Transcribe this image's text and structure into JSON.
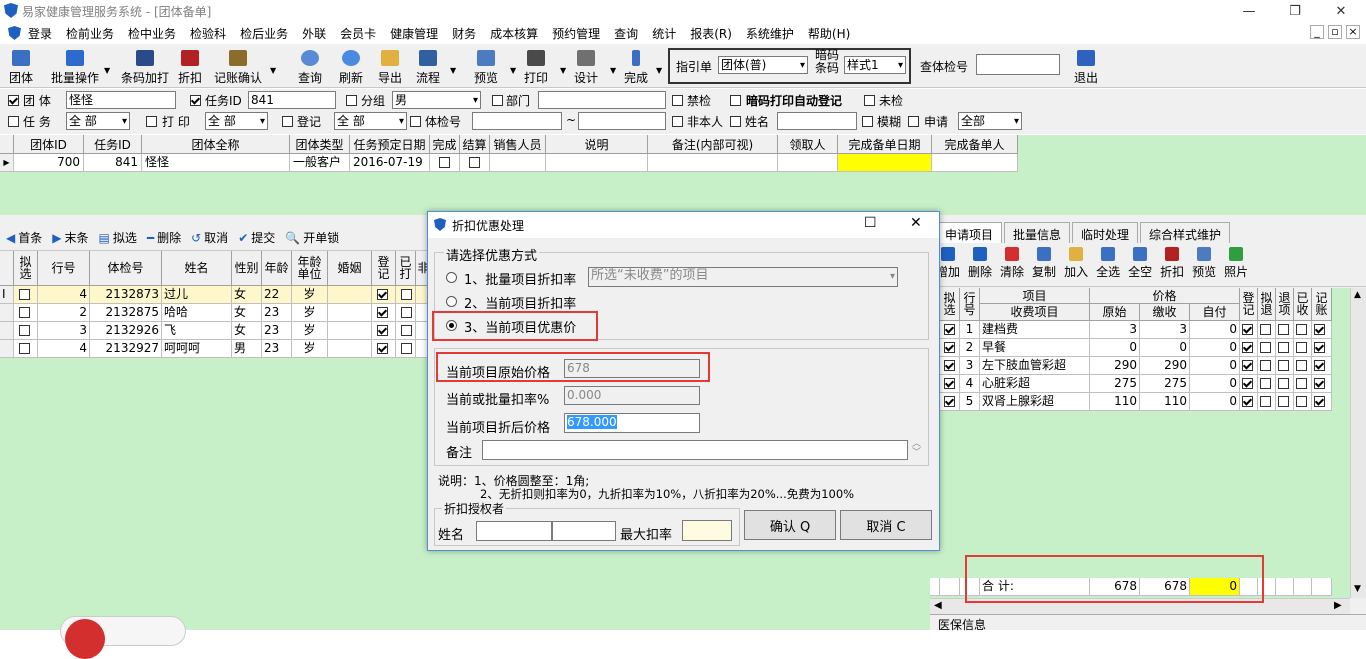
{
  "window": {
    "title": "易家健康管理服务系统 - [团体备单]",
    "minimize": "—",
    "restore": "❐",
    "close": "✕"
  },
  "mdi": {
    "minimize": "_",
    "restore": "▫",
    "close": "×"
  },
  "menu": [
    "登录",
    "检前业务",
    "检中业务",
    "检验科",
    "检后业务",
    "外联",
    "会员卡",
    "健康管理",
    "财务",
    "成本核算",
    "预约管理",
    "查询",
    "统计",
    "报表(R)",
    "系统维护",
    "帮助(H)"
  ],
  "toolbar": {
    "buttons": [
      "团体",
      "批量操作",
      "条码加打",
      "折扣",
      "记账确认",
      "查询",
      "刷新",
      "导出",
      "流程",
      "预览",
      "打印",
      "设计",
      "完成",
      "退出"
    ],
    "guide_label": "指引单",
    "guide_value": "团体(普)",
    "barcode_label1": "暗码",
    "barcode_label2": "条码",
    "barcode_value": "样式1",
    "check_label": "查体检号",
    "check_value": ""
  },
  "filter1": {
    "team_label": "团  体",
    "team_value": "怪怪",
    "task_label": "任务ID",
    "task_value": "841",
    "group_label": "分组",
    "group_value": "男",
    "dept_label": "部门",
    "dept_value": "",
    "forbid_label": "禁检",
    "auto_label": "暗码打印自动登记",
    "nocheck_label": "未检"
  },
  "filter2": {
    "task_label": "任  务",
    "task_value": "全  部",
    "print_label": "打  印",
    "print_value": "全  部",
    "reg_label": "登记",
    "reg_value": "全  部",
    "checkno_label": "体检号",
    "tilde": "~",
    "self_label": "非本人",
    "name_label": "姓名",
    "fuzzy_label": "模糊",
    "apply_label": "申请",
    "apply_value": "全部"
  },
  "top_grid": {
    "headers": [
      "团体ID",
      "任务ID",
      "团体全称",
      "团体类型",
      "任务预定日期",
      "完成",
      "结算",
      "销售人员",
      "说明",
      "备注(内部可视)",
      "领取人",
      "完成备单日期",
      "完成备单人"
    ],
    "row": {
      "id": "700",
      "task": "841",
      "name": "怪怪",
      "type": "一般客户",
      "date": "2016-07-19"
    }
  },
  "left_toolbar": [
    "首条",
    "末条",
    "拟选",
    "删除",
    "取消",
    "提交",
    "开单锁"
  ],
  "left_grid": {
    "headers": [
      "拟选",
      "行号",
      "体检号",
      "姓名",
      "性别",
      "年龄",
      "年龄单位",
      "婚姻",
      "登记",
      "已打",
      "非"
    ],
    "rows": [
      {
        "row": "4",
        "no": "2132873",
        "name": "过儿",
        "sex": "女",
        "age": "22",
        "unit": "岁"
      },
      {
        "row": "2",
        "no": "2132875",
        "name": "哈哈",
        "sex": "女",
        "age": "23",
        "unit": "岁"
      },
      {
        "row": "3",
        "no": "2132926",
        "name": "飞",
        "sex": "女",
        "age": "23",
        "unit": "岁"
      },
      {
        "row": "4",
        "no": "2132927",
        "name": "呵呵呵",
        "sex": "男",
        "age": "23",
        "unit": "岁"
      }
    ]
  },
  "right_tabs": [
    "申请项目",
    "批量信息",
    "临时处理",
    "综合样式维护"
  ],
  "right_toolbar": [
    "增加",
    "删除",
    "清除",
    "复制",
    "加入",
    "全选",
    "全空",
    "折扣",
    "预览",
    "照片"
  ],
  "right_grid": {
    "headers": {
      "pick": "拟选",
      "line": "行号",
      "item": "项目",
      "fee": "收费项目",
      "price": "价格",
      "orig": "原始",
      "paid": "缴收",
      "self": "自付",
      "reg": "登记",
      "pre": "拟退",
      "ret": "退项",
      "done": "已收",
      "acct": "记账"
    },
    "rows": [
      {
        "line": "1",
        "name": "建档费",
        "orig": "3",
        "paid": "3",
        "self": "0"
      },
      {
        "line": "2",
        "name": "早餐",
        "orig": "0",
        "paid": "0",
        "self": "0"
      },
      {
        "line": "3",
        "name": "左下肢血管彩超",
        "orig": "290",
        "paid": "290",
        "self": "0"
      },
      {
        "line": "4",
        "name": "心脏彩超",
        "orig": "275",
        "paid": "275",
        "self": "0"
      },
      {
        "line": "5",
        "name": "双肾上腺彩超",
        "orig": "110",
        "paid": "110",
        "self": "0"
      }
    ],
    "total": {
      "label": "合  计:",
      "orig": "678",
      "paid": "678",
      "self": "0"
    }
  },
  "bottom_right": "医保信息",
  "dialog": {
    "title": "折扣优惠处理",
    "maximize": "☐",
    "close": "✕",
    "group_title": "请选择优惠方式",
    "opt1": "1、批量项目折扣率",
    "opt1_value": "所选“未收费”的项目",
    "opt2": "2、当前项目折扣率",
    "opt3": "3、当前项目优惠价",
    "orig_label": "当前项目原始价格",
    "orig_value": "678",
    "rate_label": "当前或批量扣率%",
    "rate_value": "0.000",
    "after_label": "当前项目折后价格",
    "after_value": "678.000",
    "note_label": "备注",
    "note_value": "",
    "explain1": "说明：1、价格圆整至：1角;",
    "explain2": "2、无折扣则扣率为0，九折扣率为10%，八折扣率为20%...免费为100%",
    "auth_title": "折扣授权者",
    "name_label": "姓名",
    "max_label": "最大扣率",
    "ok": "确认 Q",
    "cancel": "取消 C"
  },
  "colors": {
    "green": "#c8f0c8",
    "highlight": "#ffff00",
    "red": "#e53935",
    "dialog_border": "#4f8fd6",
    "select": "#3399ff"
  }
}
